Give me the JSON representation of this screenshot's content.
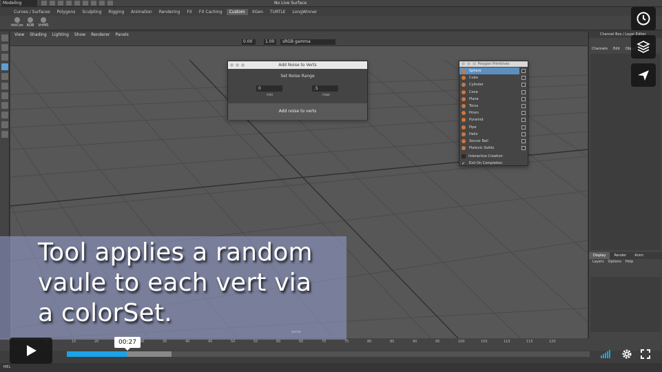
{
  "app": {
    "mode": "Modeling",
    "live_surface": "No Live Surface"
  },
  "shelf_tabs": [
    "Curves / Surfaces",
    "Polygons",
    "Sculpting",
    "Rigging",
    "Animation",
    "Rendering",
    "FX",
    "FX Caching",
    "Custom",
    "XGen",
    "TURTLE",
    "LongWinner"
  ],
  "shelf_active_tab": "Custom",
  "shelf_items": [
    "ktkCon",
    "AOB",
    "VrtMS"
  ],
  "viewport": {
    "menu": [
      "View",
      "Shading",
      "Lighting",
      "Show",
      "Renderer",
      "Panels"
    ],
    "exposure": "0.00",
    "gamma_value": "1.00",
    "color_space": "sRGB gamma",
    "camera": "persp"
  },
  "noise_window": {
    "title": "Add Noise to Verts",
    "section": "Set Noise Range",
    "min_value": "0",
    "max_value": ".5",
    "min_label": "min",
    "max_label": "max",
    "button": "Add noise to verts"
  },
  "primitives": {
    "title": "Polygon Primitives",
    "items": [
      "Sphere",
      "Cube",
      "Cylinder",
      "Cone",
      "Plane",
      "Torus",
      "Prism",
      "Pyramid",
      "Pipe",
      "Helix",
      "Soccer Ball",
      "Platonic Solids"
    ],
    "highlighted": "Sphere",
    "options": [
      "Interactive Creation",
      "Exit On Completion"
    ],
    "exit_on_completion_checked": true
  },
  "channel_box": {
    "header": "Channel Box / Layer Editor",
    "menu": [
      "Channels",
      "Edit",
      "Object"
    ]
  },
  "layer_panel": {
    "tabs": [
      "Display",
      "Render",
      "Anim"
    ],
    "menu": [
      "Layers",
      "Options",
      "Help"
    ]
  },
  "timeline": {
    "ticks": [
      "1",
      "15",
      "20",
      "25",
      "30",
      "35",
      "40",
      "45",
      "50",
      "55",
      "60",
      "65",
      "70",
      "75",
      "80",
      "85",
      "90",
      "95",
      "100",
      "105",
      "110",
      "115",
      "120"
    ]
  },
  "mel_label": "MEL",
  "caption": "Tool applies a random\nvaule to each vert via\na colorSet.",
  "player": {
    "current_time": "00:27",
    "progress": 0.115,
    "buffered": 0.2,
    "accent": "#1aa3e8"
  }
}
